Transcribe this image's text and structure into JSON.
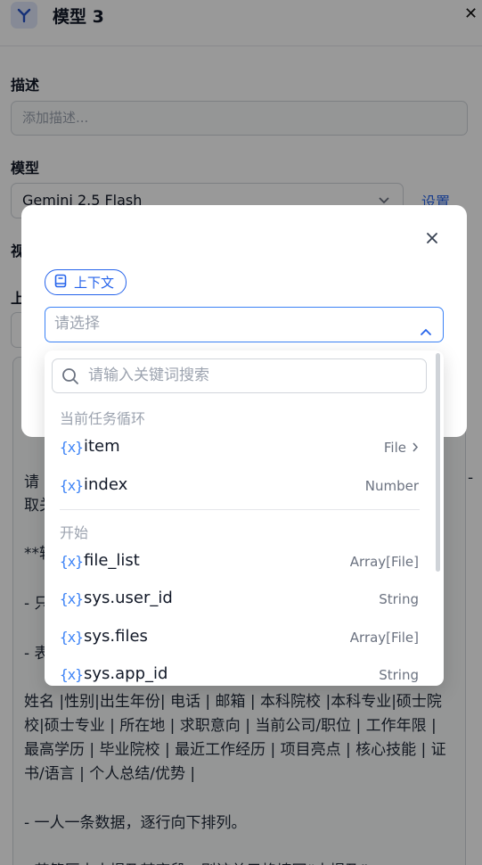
{
  "panel": {
    "title": "模型 3",
    "close_icon": "close-icon"
  },
  "description": {
    "label": "描述",
    "placeholder": "添加描述..."
  },
  "model": {
    "label": "模型",
    "value": "Gemini 2.5 Flash",
    "settings_label": "设置"
  },
  "background_fragments": {
    "visual_label": "视",
    "context_label": "上"
  },
  "prompt": {
    "lines": [
      "请",
      "取关",
      "**转",
      "- 只",
      "- 表",
      "姓名 |性别|出生年份| 电话 | 邮箱 | 本科院校 |本科专业|硕士院",
      "校|硕士专业 | 所在地 | 求职意向 | 当前公司/职位 | 工作年限 |",
      "最高学历 | 毕业院校 | 最近工作经历 | 项目亮点 | 核心技能 | 证",
      "书/语言 | 个人总结/优势 |",
      "- 一人一条数据，逐行向下排列。",
      "- 若简历中未提及某字段，则该单元格填写“未提及”"
    ],
    "right_fragment": "-"
  },
  "modal": {
    "context_chip_label": "上下文",
    "select_placeholder": "请选择",
    "search_placeholder": "请输入关键词搜索",
    "groups": [
      {
        "title": "当前任务循环",
        "items": [
          {
            "var": "{x}",
            "name": "item",
            "type": "File",
            "has_arrow": true
          },
          {
            "var": "{x}",
            "name": "index",
            "type": "Number",
            "has_arrow": false
          }
        ]
      },
      {
        "title": "开始",
        "items": [
          {
            "var": "{x}",
            "name": "file_list",
            "type": "Array[File]",
            "has_arrow": false
          },
          {
            "var": "{x}",
            "name": "sys.user_id",
            "type": "String",
            "has_arrow": false
          },
          {
            "var": "{x}",
            "name": "sys.files",
            "type": "Array[File]",
            "has_arrow": false
          },
          {
            "var": "{x}",
            "name": "sys.app_id",
            "type": "String",
            "has_arrow": false
          }
        ]
      }
    ]
  },
  "colors": {
    "accent": "#2563eb",
    "overlay": "rgba(0,0,0,0.40)"
  }
}
